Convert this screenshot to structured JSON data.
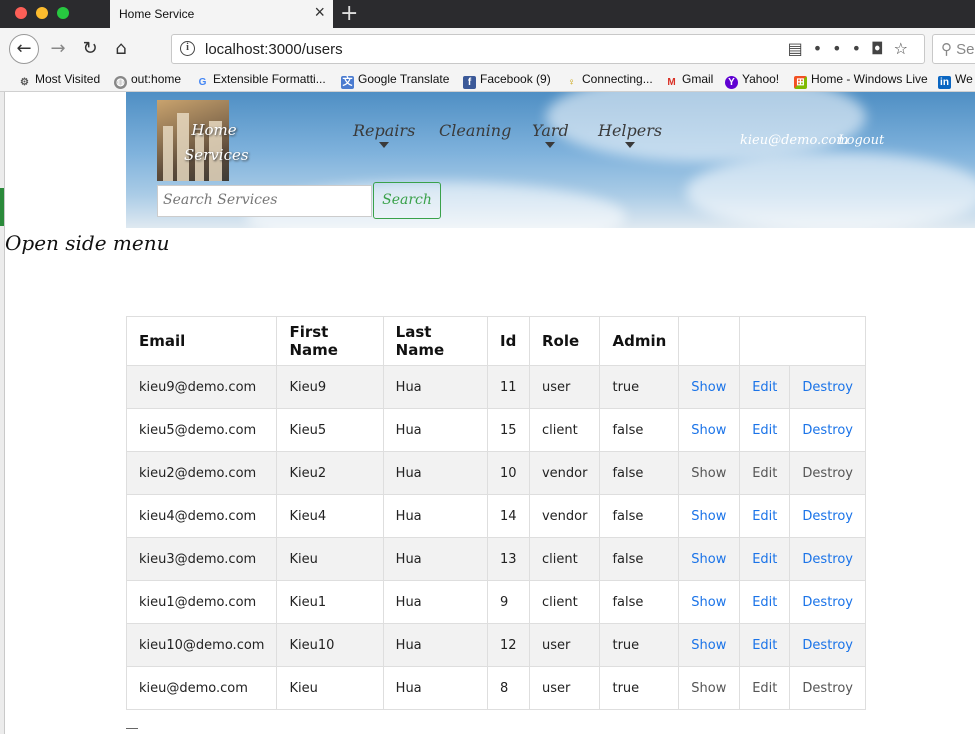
{
  "browser": {
    "tab_title": "Home Service",
    "url": "localhost:3000/users",
    "search_placeholder": "Se",
    "bookmarks": [
      {
        "label": "Most Visited",
        "icon": "gear-icon",
        "color": "#666666"
      },
      {
        "label": "out:home",
        "icon": "globe-icon",
        "color": "#777777"
      },
      {
        "label": "Extensible Formatti...",
        "icon": "google-icon",
        "color": "#4285f4"
      },
      {
        "label": "Google Translate",
        "icon": "translate-icon",
        "color": "#4a7bd0"
      },
      {
        "label": "Facebook (9)",
        "icon": "facebook-icon",
        "color": "#3b5998"
      },
      {
        "label": "Connecting...",
        "icon": "mic-icon",
        "color": "#c8a000"
      },
      {
        "label": "Gmail",
        "icon": "gmail-icon",
        "color": "#d93025"
      },
      {
        "label": "Yahoo!",
        "icon": "yahoo-icon",
        "color": "#6001d2"
      },
      {
        "label": "Home - Windows Live",
        "icon": "windows-icon",
        "color": "#e07b00"
      },
      {
        "label": "We",
        "icon": "linkedin-icon",
        "color": "#0a66c2"
      }
    ]
  },
  "site": {
    "logo_line1": "Home",
    "logo_line2": "Services",
    "menu": [
      "Repairs",
      "Cleaning",
      "Yard",
      "Helpers"
    ],
    "user_email": "kieu@demo.com",
    "logout_label": "Logout",
    "search_placeholder": "Search Services",
    "search_button": "Search",
    "open_side_menu": "Open side menu"
  },
  "table": {
    "headers": [
      "Email",
      "First Name",
      "Last Name",
      "Id",
      "Role",
      "Admin",
      "",
      ""
    ],
    "rows": [
      {
        "email": "kieu9@demo.com",
        "first": "Kieu9",
        "last": "Hua",
        "id": "11",
        "role": "user",
        "admin": "true",
        "show": "Show",
        "edit": "Edit",
        "destroy": "Destroy",
        "links_active": true
      },
      {
        "email": "kieu5@demo.com",
        "first": "Kieu5",
        "last": "Hua",
        "id": "15",
        "role": "client",
        "admin": "false",
        "show": "Show",
        "edit": "Edit",
        "destroy": "Destroy",
        "links_active": true
      },
      {
        "email": "kieu2@demo.com",
        "first": "Kieu2",
        "last": "Hua",
        "id": "10",
        "role": "vendor",
        "admin": "false",
        "show": "Show",
        "edit": "Edit",
        "destroy": "Destroy",
        "links_active": false
      },
      {
        "email": "kieu4@demo.com",
        "first": "Kieu4",
        "last": "Hua",
        "id": "14",
        "role": "vendor",
        "admin": "false",
        "show": "Show",
        "edit": "Edit",
        "destroy": "Destroy",
        "links_active": true
      },
      {
        "email": "kieu3@demo.com",
        "first": "Kieu",
        "last": "Hua",
        "id": "13",
        "role": "client",
        "admin": "false",
        "show": "Show",
        "edit": "Edit",
        "destroy": "Destroy",
        "links_active": true
      },
      {
        "email": "kieu1@demo.com",
        "first": "Kieu1",
        "last": "Hua",
        "id": "9",
        "role": "client",
        "admin": "false",
        "show": "Show",
        "edit": "Edit",
        "destroy": "Destroy",
        "links_active": true
      },
      {
        "email": "kieu10@demo.com",
        "first": "Kieu10",
        "last": "Hua",
        "id": "12",
        "role": "user",
        "admin": "true",
        "show": "Show",
        "edit": "Edit",
        "destroy": "Destroy",
        "links_active": true
      },
      {
        "email": "kieu@demo.com",
        "first": "Kieu",
        "last": "Hua",
        "id": "8",
        "role": "user",
        "admin": "true",
        "show": "Show",
        "edit": "Edit",
        "destroy": "Destroy",
        "links_active": false
      }
    ]
  },
  "colors": {
    "link": "#1a73e8",
    "muted_link": "#555555",
    "search_green": "#3aa14a"
  }
}
